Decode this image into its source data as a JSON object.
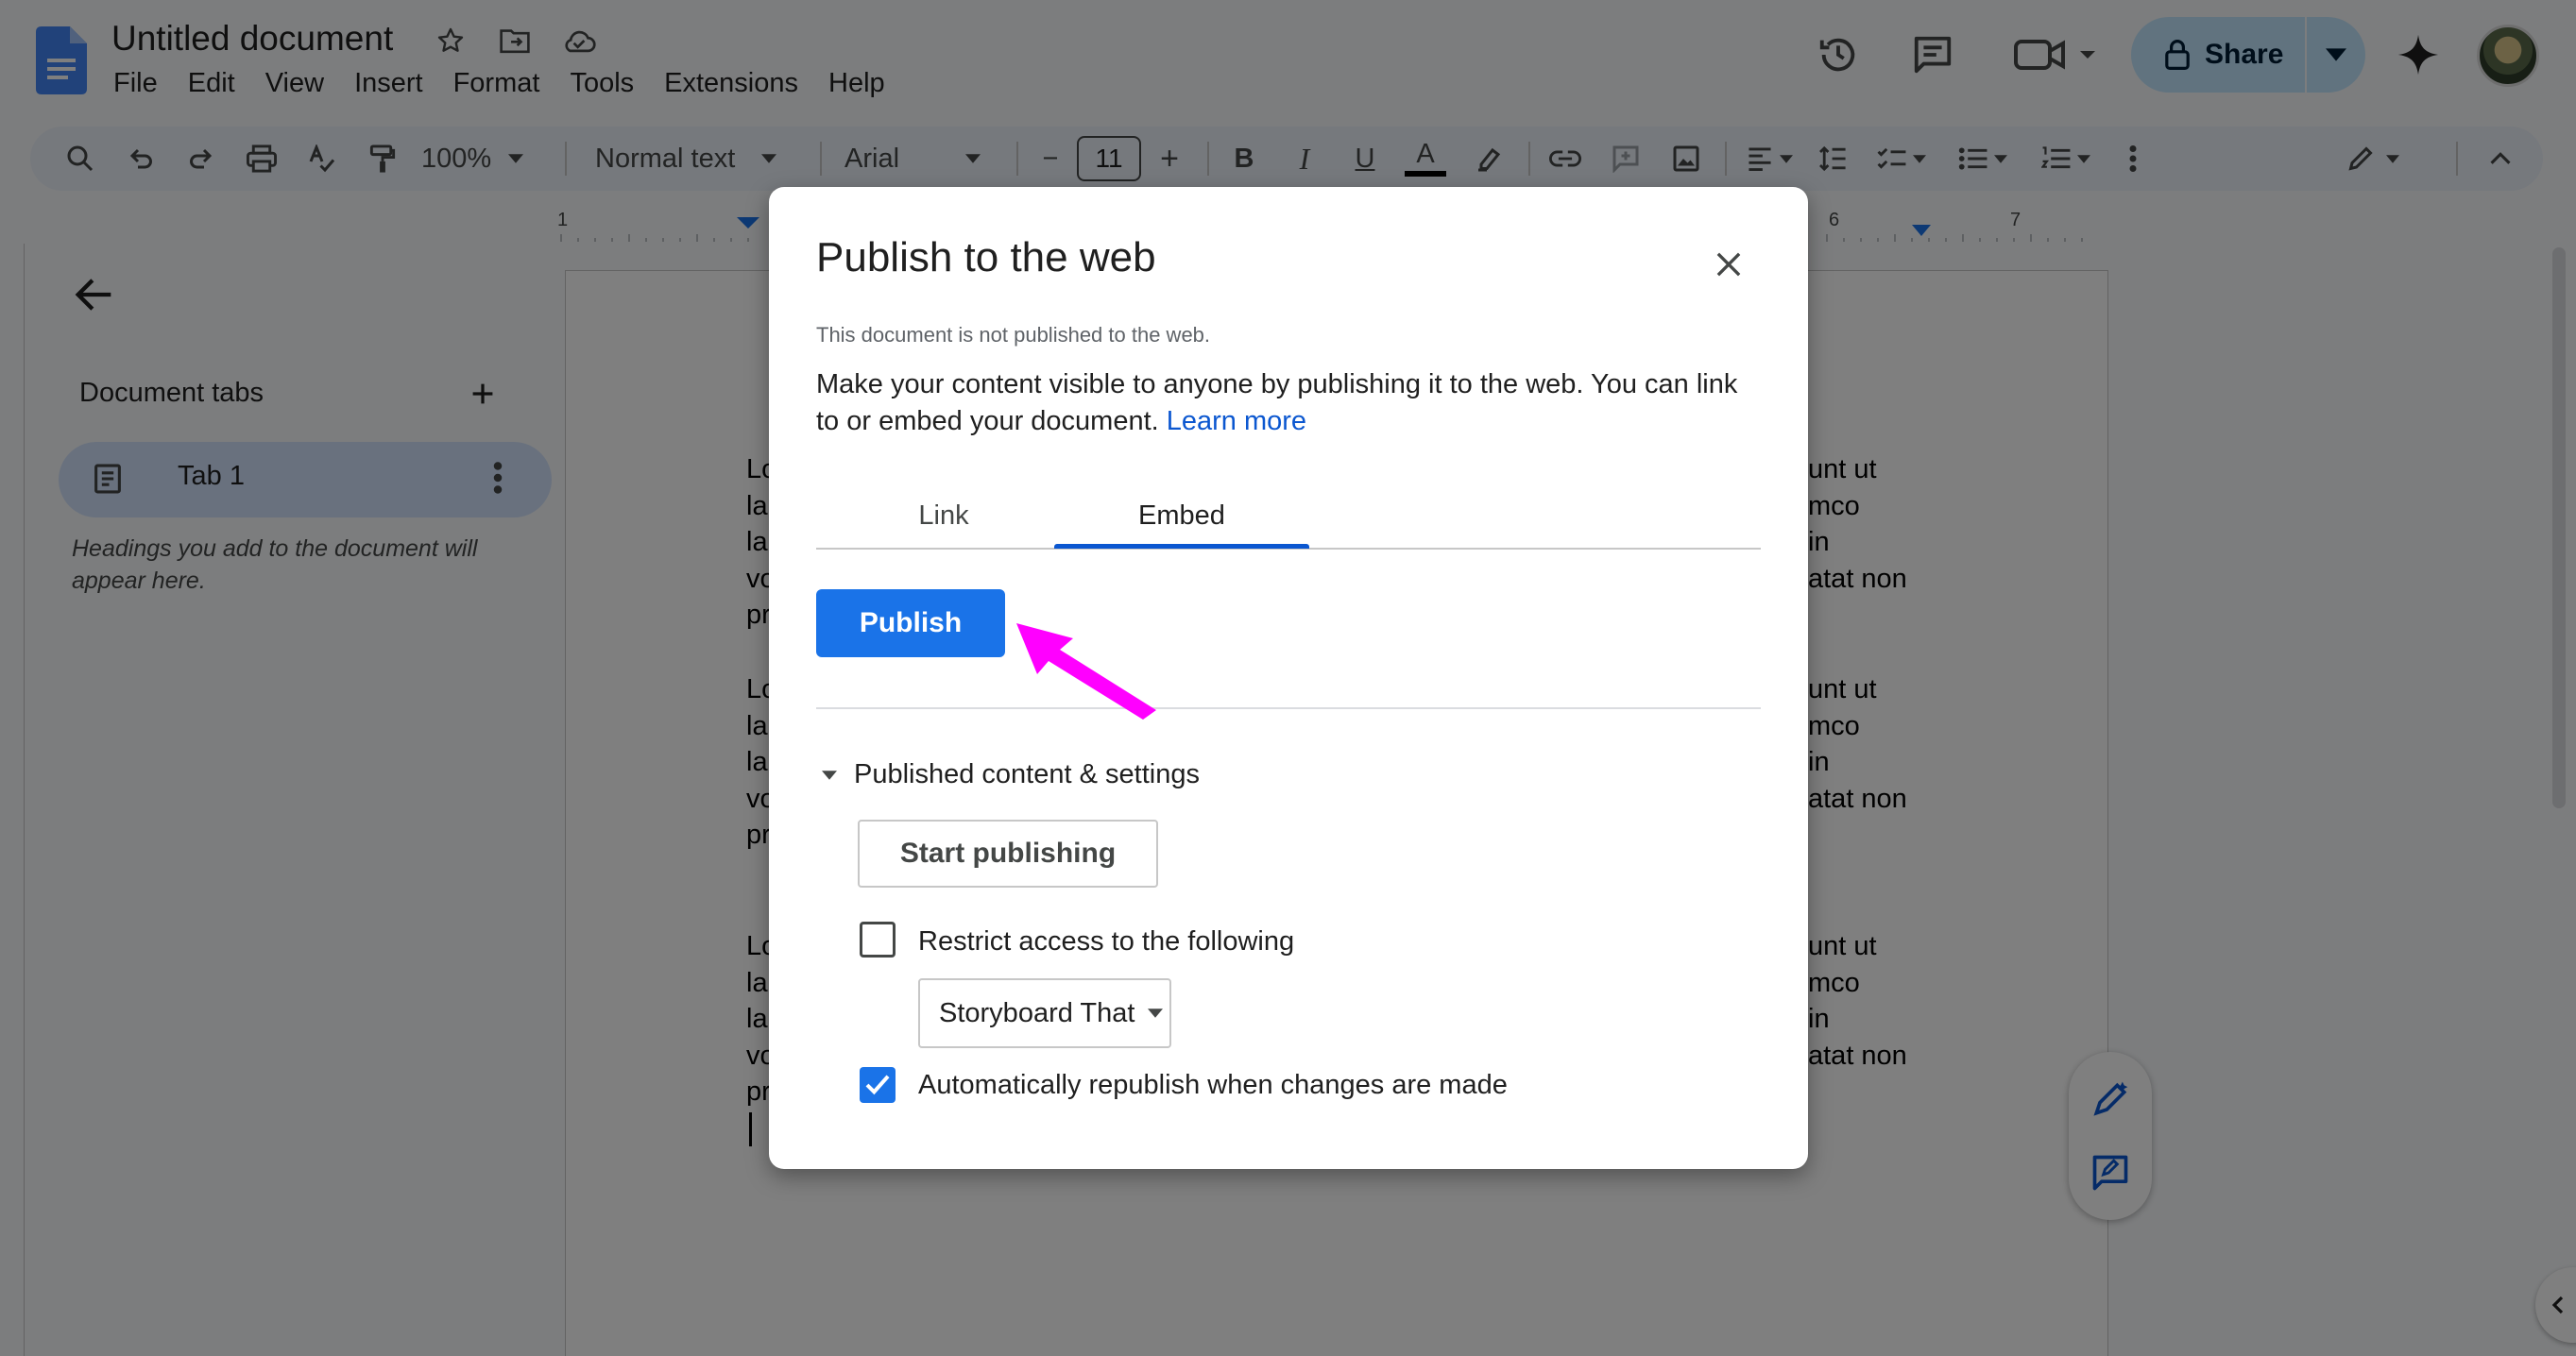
{
  "app": {
    "doc_title": "Untitled document",
    "menu": [
      "File",
      "Edit",
      "View",
      "Insert",
      "Format",
      "Tools",
      "Extensions",
      "Help"
    ],
    "share_label": "Share",
    "accent_color": "#0b57d0"
  },
  "toolbar": {
    "zoom": "100%",
    "style": "Normal text",
    "font": "Arial",
    "font_size": "11",
    "minus": "−",
    "plus": "+",
    "bold": "B",
    "italic": "I",
    "underline": "U",
    "text_color": "A"
  },
  "ruler": {
    "numbers": [
      "1",
      "6",
      "7"
    ]
  },
  "sidebar": {
    "title": "Document tabs",
    "tab_label": "Tab 1",
    "hint": "Headings you add to the document will appear here."
  },
  "document": {
    "left_fragments": [
      "Lo",
      "la",
      "la",
      "vo",
      "pr",
      "Lo",
      "la",
      "la",
      "vo",
      "pr",
      "Lo",
      "la",
      "la",
      "vo",
      "pr"
    ],
    "right_fragments": [
      "unt ut",
      "mco",
      "in",
      "atat non",
      "unt ut",
      "mco",
      "in",
      "atat non",
      "unt ut",
      "mco",
      "in",
      "atat non"
    ]
  },
  "dialog": {
    "title": "Publish to the web",
    "status": "This document is not published to the web.",
    "description": "Make your content visible to anyone by publishing it to the web. You can link to or embed your document.",
    "learn_more": "Learn more",
    "tabs": [
      "Link",
      "Embed"
    ],
    "active_tab": "Embed",
    "publish_label": "Publish",
    "settings_label": "Published content & settings",
    "start_publishing_label": "Start publishing",
    "restrict_label": "Restrict access to the following",
    "restrict_checked": false,
    "org_option": "Storyboard That",
    "auto_republish_label": "Automatically republish when changes are made",
    "auto_republish_checked": true
  },
  "icons": {
    "title_bar": [
      "star-icon",
      "move-folder-icon",
      "cloud-status-icon"
    ],
    "top_right": [
      "history-icon",
      "comments-icon",
      "meet-icon",
      "lock-icon",
      "gemini-icon"
    ],
    "annotation_arrow_color": "#ff00ff"
  }
}
